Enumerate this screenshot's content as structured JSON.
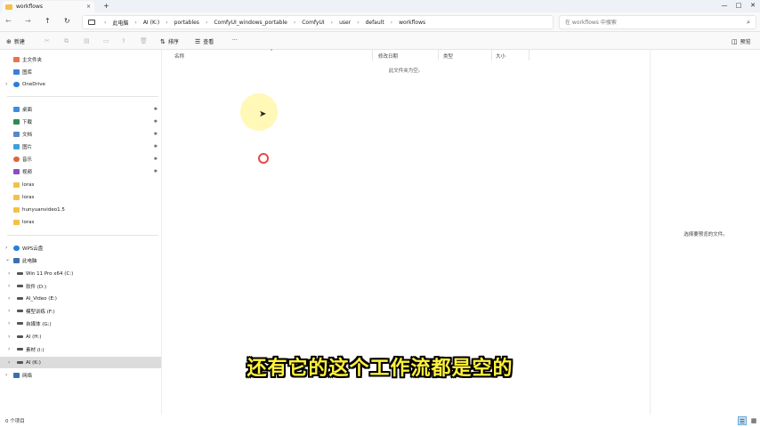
{
  "window": {
    "tab_title": "workflows",
    "tab_close": "×",
    "new_tab": "+",
    "min": "—",
    "max": "□",
    "close": "✕"
  },
  "nav": {
    "back": "←",
    "forward": "→",
    "up": "↑",
    "refresh": "↻",
    "breadcrumbs": [
      "此电脑",
      "AI (K:)",
      "portables",
      "ComfyUI_windows_portable",
      "ComfyUI",
      "user",
      "default",
      "workflows"
    ],
    "separator": "›",
    "search_placeholder": "在 workflows 中搜索"
  },
  "toolbar": {
    "new_label": "新建",
    "sort_label": "排序",
    "view_label": "查看",
    "more_label": "···",
    "details_label": "预览"
  },
  "sidebar": {
    "items": [
      {
        "label": "主文件夹",
        "color": "#e8744a"
      },
      {
        "label": "图库",
        "color": "#3b7fd6"
      },
      {
        "label": "OneDrive",
        "color": "#2a7fd9"
      },
      {
        "label": "桌面",
        "color": "#3d8ee0"
      },
      {
        "label": "下载",
        "color": "#2f8a4f"
      },
      {
        "label": "文档",
        "color": "#5b86c8"
      },
      {
        "label": "图片",
        "color": "#3fa0d8"
      },
      {
        "label": "音乐",
        "color": "#e0653a"
      },
      {
        "label": "视频",
        "color": "#8a4dc9"
      },
      {
        "label": "loras",
        "color": "#f4c048"
      },
      {
        "label": "loras",
        "color": "#f4c048"
      },
      {
        "label": "hunyuanvideo1.5",
        "color": "#f4c048"
      },
      {
        "label": "loras",
        "color": "#f4c048"
      },
      {
        "label": "WPS云盘",
        "color": "#2a7fd9"
      },
      {
        "label": "此电脑",
        "color": "#3d6fb0"
      },
      {
        "label": "Win 11 Pro x64 (C:)",
        "color": "#555555"
      },
      {
        "label": "软件 (D:)",
        "color": "#555555"
      },
      {
        "label": "AI_Video (E:)",
        "color": "#555555"
      },
      {
        "label": "模型训练 (F:)",
        "color": "#555555"
      },
      {
        "label": "自媒体 (G:)",
        "color": "#555555"
      },
      {
        "label": "AI (H:)",
        "color": "#555555"
      },
      {
        "label": "素材 (I:)",
        "color": "#555555"
      },
      {
        "label": "AI (K:)",
        "color": "#555555"
      },
      {
        "label": "网络",
        "color": "#3d6fb0"
      }
    ],
    "chevron": "›",
    "expanded_chevron": "⌄",
    "pin": "✱"
  },
  "content": {
    "col_name": "名称",
    "col_modified": "修改日期",
    "col_type": "类型",
    "col_size": "大小",
    "empty_text": "此文件夹为空。"
  },
  "preview": {
    "text": "选择要预览的文件。"
  },
  "status": {
    "count": "0 个项目"
  },
  "subtitle": "还有它的这个工作流都是空的"
}
